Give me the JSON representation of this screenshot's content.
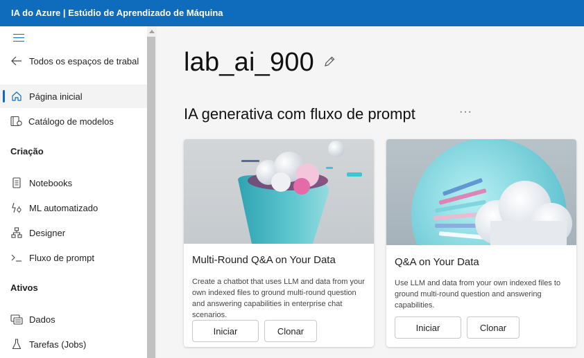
{
  "header": {
    "title": "IA do Azure | Estúdio de Aprendizado de Máquina"
  },
  "sidebar": {
    "back_label": "Todos os espaços de trabal",
    "items": [
      {
        "label": "Página inicial",
        "icon": "home-icon"
      },
      {
        "label": "Catálogo de modelos",
        "icon": "model-catalog-icon"
      },
      {
        "label": "Notebooks",
        "icon": "notebook-icon"
      },
      {
        "label": "ML automatizado",
        "icon": "automl-icon"
      },
      {
        "label": "Designer",
        "icon": "designer-icon"
      },
      {
        "label": "Fluxo de prompt",
        "icon": "prompt-flow-icon"
      },
      {
        "label": "Dados",
        "icon": "data-icon"
      },
      {
        "label": "Tarefas (Jobs)",
        "icon": "jobs-icon"
      }
    ],
    "sections": {
      "creation": "Criação",
      "assets": "Ativos"
    }
  },
  "main": {
    "workspace_title": "lab_ai_900",
    "section_title": "IA generativa com fluxo de prompt",
    "cards": [
      {
        "title": "Multi-Round Q&A on Your Data",
        "description": "Create a chatbot that uses LLM and data from your own indexed files to ground multi-round question and answering capabilities in enterprise chat scenarios.",
        "start_label": "Iniciar",
        "clone_label": "Clonar"
      },
      {
        "title": "Q&A on Your Data",
        "description": "Use LLM and data from your own indexed files to ground multi-round question and answering capabilities.",
        "start_label": "Iniciar",
        "clone_label": "Clonar"
      }
    ]
  },
  "colors": {
    "accent": "#0f6cbd",
    "topbar": "#0f6cbd"
  }
}
